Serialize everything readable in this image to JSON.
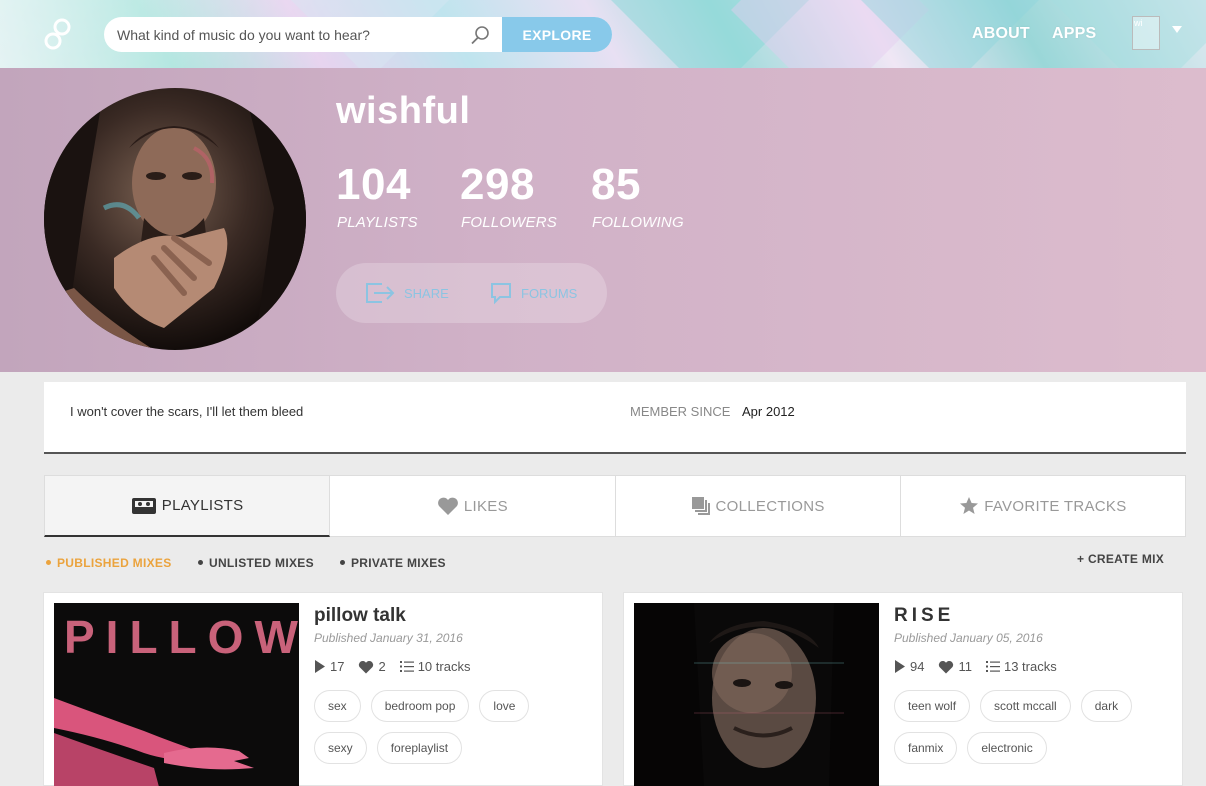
{
  "header": {
    "search_placeholder": "What kind of music do you want to hear?",
    "explore_label": "EXPLORE",
    "nav": [
      "ABOUT",
      "APPS"
    ],
    "avatar_alt": "wi"
  },
  "profile": {
    "username": "wishful",
    "stats": [
      {
        "value": "104",
        "label": "PLAYLISTS"
      },
      {
        "value": "298",
        "label": "FOLLOWERS"
      },
      {
        "value": "85",
        "label": "FOLLOWING"
      }
    ],
    "actions": {
      "share": "SHARE",
      "forums": "FORUMS"
    }
  },
  "about": {
    "bio": "I won't cover the scars, I'll let them bleed",
    "member_since_label": "MEMBER SINCE",
    "member_since_value": "Apr 2012"
  },
  "tabs": [
    "PLAYLISTS",
    "LIKES",
    "COLLECTIONS",
    "FAVORITE TRACKS"
  ],
  "subtabs": [
    "PUBLISHED MIXES",
    "UNLISTED MIXES",
    "PRIVATE MIXES"
  ],
  "create_mix": "+ CREATE MIX",
  "mixes": [
    {
      "cover_text": "PILLOW",
      "title": "pillow talk",
      "published": "Published January 31, 2016",
      "plays": "17",
      "likes": "2",
      "tracks": "10 tracks",
      "tags": [
        "sex",
        "bedroom pop",
        "love",
        "sexy",
        "foreplaylist"
      ]
    },
    {
      "title": "RISE",
      "published": "Published January 05, 2016",
      "plays": "94",
      "likes": "11",
      "tracks": "13 tracks",
      "tags": [
        "teen wolf",
        "scott mccall",
        "dark",
        "fanmix",
        "electronic"
      ]
    }
  ],
  "colors": {
    "accent": "#88c9ea",
    "active_subtab": "#eba33d",
    "banner": "#d0b1c7"
  }
}
